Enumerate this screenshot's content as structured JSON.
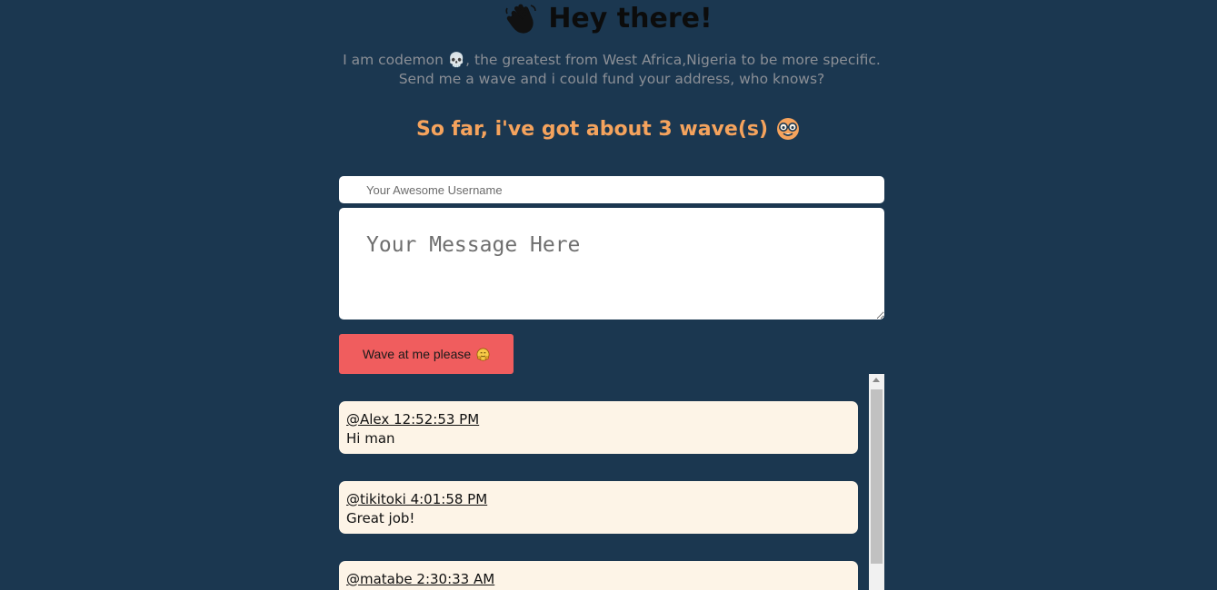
{
  "header": {
    "icon": "waving-hand-icon",
    "title": "Hey there!"
  },
  "intro": {
    "text": "I am codemon 💀, the greatest from West Africa,Nigeria to be more specific. Send me a wave and i could fund your address, who knows?"
  },
  "wave_count": {
    "text": "So far, i've got about 3 wave(s)",
    "icon": "nerd-face-icon",
    "count": 3
  },
  "form": {
    "username_placeholder": "Your Awesome Username",
    "username_value": "",
    "message_placeholder": "Your Message Here",
    "message_value": "",
    "button_label": "Wave at me please",
    "button_icon": "hugging-face-icon"
  },
  "waves": [
    {
      "meta": "@Alex 12:52:53 PM",
      "message": "Hi man"
    },
    {
      "meta": "@tikitoki 4:01:58 PM",
      "message": "Great job!"
    },
    {
      "meta": "@matabe 2:30:33 AM",
      "message": ""
    }
  ],
  "colors": {
    "background": "#1b3750",
    "accent": "#f5a35d",
    "button": "#f05d5e",
    "card": "#fdf4e7"
  }
}
